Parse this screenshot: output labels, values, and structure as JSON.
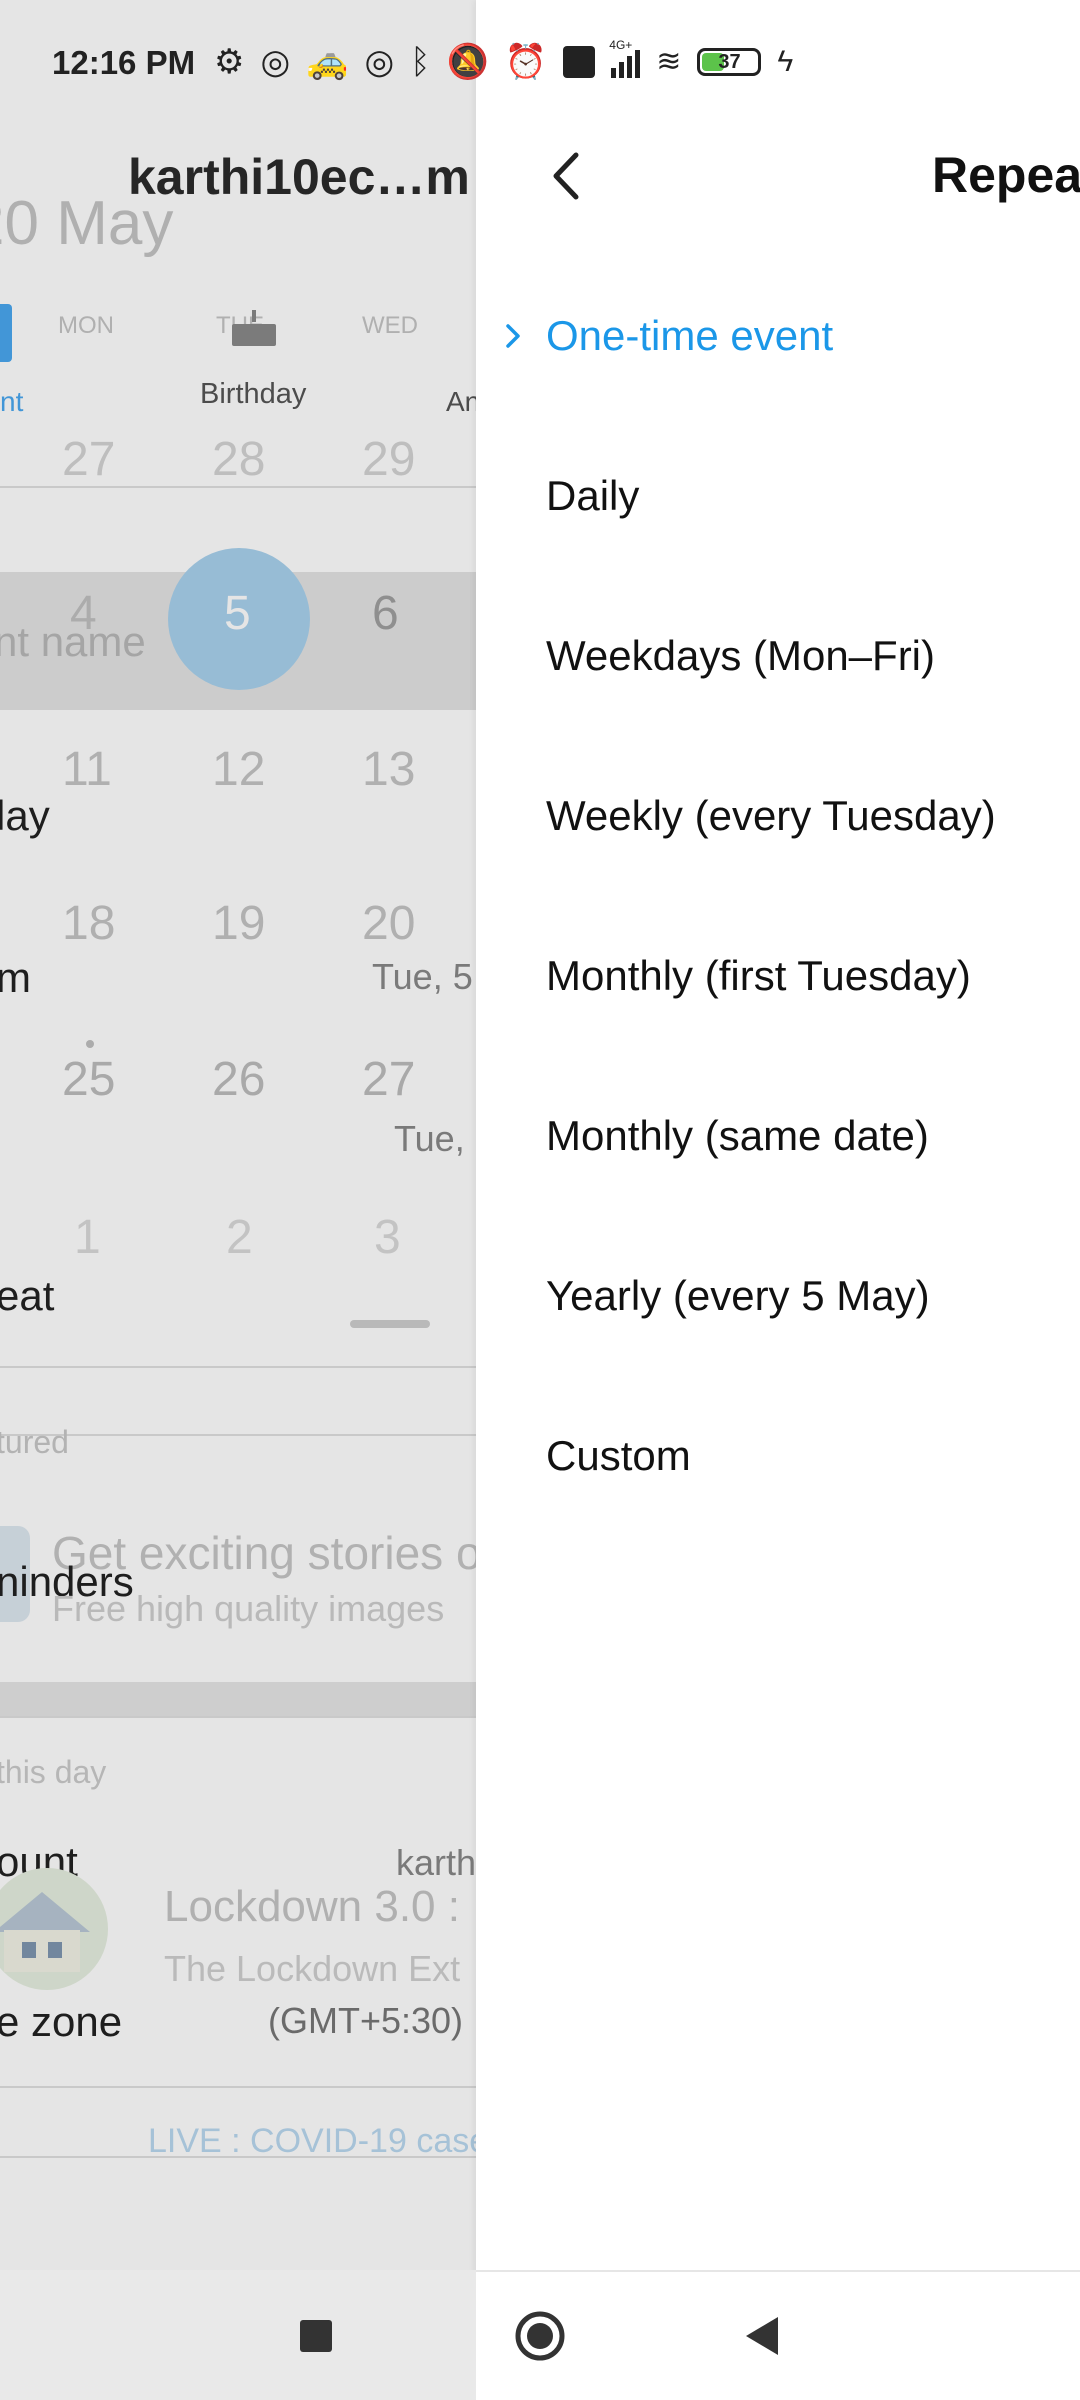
{
  "status_bar": {
    "time": "12:16 PM",
    "battery": "37",
    "network": "4G+"
  },
  "background_screen": {
    "account_title": "karthi10ec…m",
    "month": "20 May",
    "weekday_labels": [
      "MON",
      "TUE",
      "WED"
    ],
    "type_labels": [
      "nt",
      "Birthday",
      "An"
    ],
    "rows": [
      [
        "27",
        "28",
        "29"
      ],
      [
        "4",
        "5",
        "6"
      ],
      [
        "11",
        "12",
        "13"
      ],
      [
        "18",
        "19",
        "20"
      ],
      [
        "25",
        "26",
        "27"
      ],
      [
        "1",
        "2",
        "3"
      ]
    ],
    "event_name_placeholder": "nt name",
    "all_day": "lay",
    "from_label": "m",
    "from_value": "Tue, 5",
    "to_value": "Tue,",
    "repeat_label": "eat",
    "featured": "tured",
    "story_title": "Get exciting stories o",
    "story_sub": "Free high quality images",
    "reminders": "ninders",
    "this_day": "this day",
    "account_label": "ount",
    "account_value": "karth",
    "news_title": "Lockdown 3.0 :",
    "news_sub": "The Lockdown Ext",
    "time_zone_label": "e zone",
    "time_zone_value": "(GMT+5:30)",
    "live_text": "LIVE : COVID-19 case"
  },
  "sheet": {
    "title": "Repea",
    "options": [
      {
        "label": "One-time event",
        "selected": true
      },
      {
        "label": "Daily",
        "selected": false
      },
      {
        "label": "Weekdays (Mon–Fri)",
        "selected": false
      },
      {
        "label": "Weekly (every Tuesday)",
        "selected": false
      },
      {
        "label": "Monthly (first Tuesday)",
        "selected": false
      },
      {
        "label": "Monthly (same date)",
        "selected": false
      },
      {
        "label": "Yearly (every 5 May)",
        "selected": false
      },
      {
        "label": "Custom",
        "selected": false
      }
    ]
  },
  "colors": {
    "accent": "#1b97e8",
    "dim_text": "#b9b9b9"
  }
}
